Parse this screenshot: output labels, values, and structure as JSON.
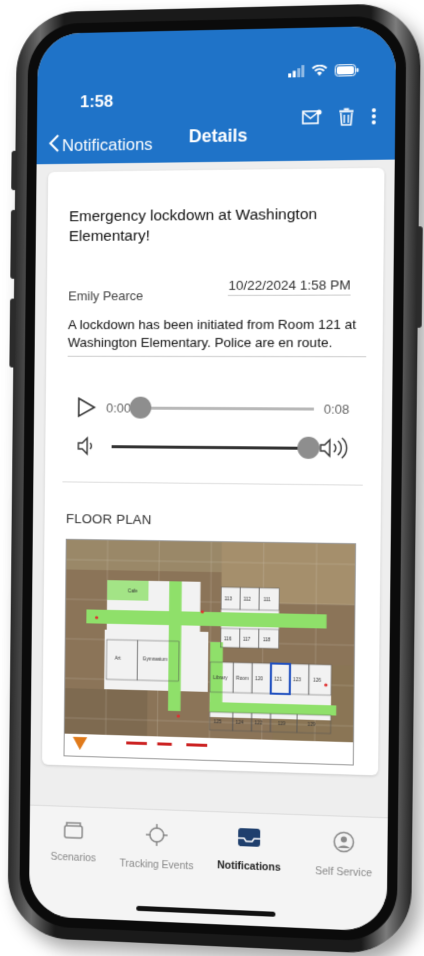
{
  "status": {
    "time": "1:58",
    "icons": [
      "signal-icon",
      "wifi-icon",
      "battery-icon"
    ]
  },
  "nav": {
    "back_label": "Notifications",
    "title": "Details",
    "actions": [
      "mail-icon",
      "trash-icon",
      "more-icon"
    ]
  },
  "message": {
    "subject": "Emergency lockdown at Washington Elementary!",
    "sender": "Emily Pearce",
    "datetime": "10/22/2024 1:58 PM",
    "body": "A lockdown has been initiated from Room 121 at Washington Elementary.  Police are en route."
  },
  "audio": {
    "current_time": "0:00",
    "duration": "0:08",
    "progress": 0,
    "volume": 1
  },
  "floor_plan": {
    "title": "FLOOR PLAN",
    "rooms": [
      "Cafe",
      "113",
      "112",
      "111",
      "110",
      "115",
      "116",
      "117",
      "118",
      "119",
      "Art",
      "Gymnasium",
      "Library",
      "Room",
      "120",
      "121",
      "122",
      "123",
      "124",
      "125",
      "126",
      "129"
    ],
    "highlighted_room": "121"
  },
  "tabs": [
    {
      "label": "Scenarios",
      "icon": "folder-icon",
      "active": false
    },
    {
      "label": "Tracking Events",
      "icon": "crosshair-icon",
      "active": false
    },
    {
      "label": "Notifications",
      "icon": "inbox-icon",
      "active": true
    },
    {
      "label": "Self Service",
      "icon": "user-circle-icon",
      "active": false
    }
  ],
  "colors": {
    "header": "#1f73c8",
    "background": "#eeeeee",
    "card": "#ffffff"
  }
}
